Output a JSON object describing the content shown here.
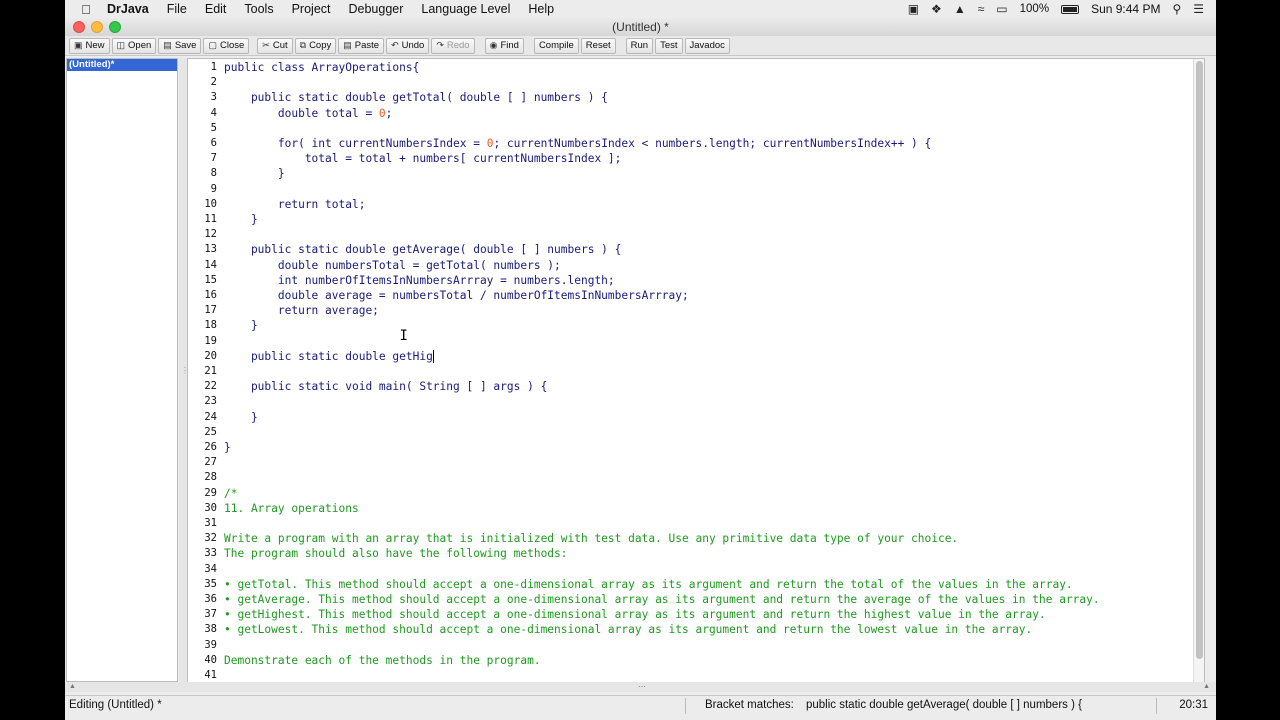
{
  "menubar": {
    "app_name": "DrJava",
    "items": [
      "File",
      "Edit",
      "Tools",
      "Project",
      "Debugger",
      "Language Level",
      "Help"
    ],
    "battery": "100%",
    "clock": "Sun 9:44 PM"
  },
  "window": {
    "title": "(Untitled) *"
  },
  "toolbar": {
    "new": "New",
    "open": "Open",
    "save": "Save",
    "close": "Close",
    "cut": "Cut",
    "copy": "Copy",
    "paste": "Paste",
    "undo": "Undo",
    "redo": "Redo",
    "find": "Find",
    "compile": "Compile",
    "reset": "Reset",
    "run": "Run",
    "test": "Test",
    "javadoc": "Javadoc"
  },
  "sidebar": {
    "documents": [
      "(Untitled)*"
    ]
  },
  "editor": {
    "lines": [
      "public class ArrayOperations{",
      "",
      "    public static double getTotal( double [ ] numbers ) {",
      "        double total = 0;",
      "",
      "        for( int currentNumbersIndex = 0; currentNumbersIndex < numbers.length; currentNumbersIndex++ ) {",
      "            total = total + numbers[ currentNumbersIndex ];",
      "        }",
      "",
      "        return total;",
      "    }",
      "",
      "    public static double getAverage( double [ ] numbers ) {",
      "        double numbersTotal = getTotal( numbers );",
      "        int numberOfItemsInNumbersArrray = numbers.length;",
      "        double average = numbersTotal / numberOfItemsInNumbersArrray;",
      "        return average;",
      "    }",
      "",
      "    public static double getHig",
      "",
      "    public static void main( String [ ] args ) {",
      "",
      "    }",
      "",
      "}",
      "",
      "",
      "/*",
      "11. Array operations",
      "",
      "Write a program with an array that is initialized with test data. Use any primitive data type of your choice.",
      "The program should also have the following methods:",
      "",
      "• getTotal. This method should accept a one-dimensional array as its argument and return the total of the values in the array.",
      "• getAverage. This method should accept a one-dimensional array as its argument and return the average of the values in the array.",
      "• getHighest. This method should accept a one-dimensional array as its argument and return the highest value in the array.",
      "• getLowest. This method should accept a one-dimensional array as its argument and return the lowest value in the array.",
      "",
      "Demonstrate each of the methods in the program.",
      ""
    ],
    "line_numbers": [
      "1",
      "2",
      "3",
      "4",
      "5",
      "6",
      "7",
      "8",
      "9",
      "10",
      "11",
      "12",
      "13",
      "14",
      "15",
      "16",
      "17",
      "18",
      "19",
      "20",
      "21",
      "22",
      "23",
      "24",
      "25",
      "26",
      "27",
      "28",
      "29",
      "30",
      "31",
      "32",
      "33",
      "34",
      "35",
      "36",
      "37",
      "38",
      "39",
      "40",
      "41"
    ],
    "comment_start_line": 29
  },
  "status": {
    "mode": "Editing (Untitled) *",
    "bracket_label": "Bracket matches:",
    "bracket_text": "public static double getAverage( double [ ] numbers ) {",
    "position": "20:31"
  },
  "colors": {
    "code": "#1a1a7e",
    "comment": "#1f9a1f",
    "number": "#f05a28",
    "selection": "#3367d6"
  }
}
